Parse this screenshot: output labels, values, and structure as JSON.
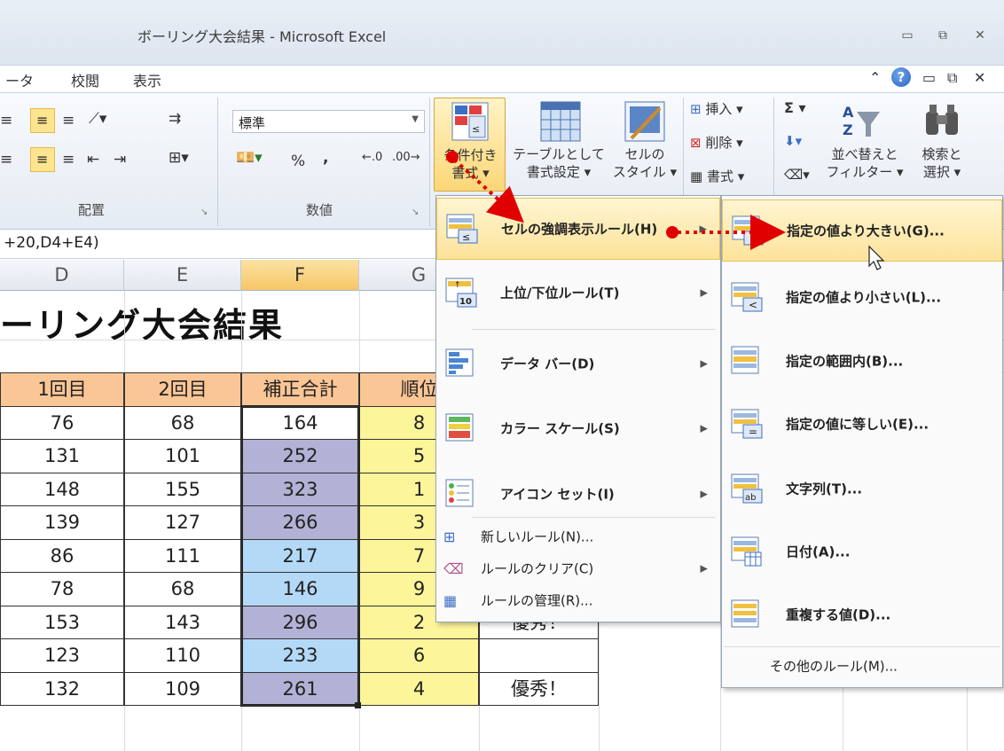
{
  "window": {
    "title": "ボーリング大会結果 - Microsoft Excel",
    "controls": [
      "▭",
      "⧉",
      "✕"
    ]
  },
  "ribbon_tabs": [
    "ータ",
    "校閲",
    "表示"
  ],
  "ribbon": {
    "group_labels": {
      "alignment": "配置",
      "number": "数値"
    },
    "number_format": "標準",
    "percent": "%",
    "comma": ",",
    "inc_decimal": ".0",
    "dec_decimal": ".00",
    "conditional_format": {
      "line1": "条件付き",
      "line2": "書式 ▾"
    },
    "format_as_table": {
      "line1": "テーブルとして",
      "line2": "書式設定 ▾"
    },
    "cell_styles": {
      "line1": "セルの",
      "line2": "スタイル ▾"
    },
    "insert": "挿入 ▾",
    "delete": "削除 ▾",
    "format": "書式 ▾",
    "sigma": "Σ ▾",
    "sort_filter": {
      "line1": "並べ替えと",
      "line2": "フィルター ▾"
    },
    "find_select": {
      "line1": "検索と",
      "line2": "選択 ▾"
    }
  },
  "formula_bar": {
    "text": "+20,D4+E4)"
  },
  "columns": [
    "D",
    "E",
    "F",
    "G"
  ],
  "sheet": {
    "title": "ーリング大会結果",
    "headers": [
      "1回目",
      "2回目",
      "補正合計",
      "順位"
    ],
    "rows": [
      {
        "d": "76",
        "e": "68",
        "f": "164",
        "g": "8",
        "h": ""
      },
      {
        "d": "131",
        "e": "101",
        "f": "252",
        "g": "5",
        "h": ""
      },
      {
        "d": "148",
        "e": "155",
        "f": "323",
        "g": "1",
        "h": ""
      },
      {
        "d": "139",
        "e": "127",
        "f": "266",
        "g": "3",
        "h": ""
      },
      {
        "d": "86",
        "e": "111",
        "f": "217",
        "g": "7",
        "h": ""
      },
      {
        "d": "78",
        "e": "68",
        "f": "146",
        "g": "9",
        "h": ""
      },
      {
        "d": "153",
        "e": "143",
        "f": "296",
        "g": "2",
        "h": "優秀！"
      },
      {
        "d": "123",
        "e": "110",
        "f": "233",
        "g": "6",
        "h": ""
      },
      {
        "d": "132",
        "e": "109",
        "f": "261",
        "g": "4",
        "h": "優秀！"
      }
    ],
    "colors": {
      "header_bg": "#fbc696",
      "f_purple": "#b2b2d6",
      "f_blue": "#b3d9f7",
      "g_yellow": "#fdf59a"
    }
  },
  "cf_menu": {
    "items": [
      {
        "label": "セルの強調表示ルール(H)",
        "icon": "highlight-rules-icon"
      },
      {
        "label": "上位/下位ルール(T)",
        "icon": "top-bottom-icon"
      },
      {
        "label": "データ バー(D)",
        "icon": "data-bars-icon"
      },
      {
        "label": "カラー スケール(S)",
        "icon": "color-scales-icon"
      },
      {
        "label": "アイコン セット(I)",
        "icon": "icon-sets-icon"
      }
    ],
    "small_items": [
      {
        "label": "新しいルール(N)...",
        "icon": "new-rule-icon"
      },
      {
        "label": "ルールのクリア(C)",
        "icon": "clear-rules-icon"
      },
      {
        "label": "ルールの管理(R)...",
        "icon": "manage-rules-icon"
      }
    ]
  },
  "highlight_submenu": {
    "items": [
      {
        "label": "指定の値より大きい(G)...",
        "icon": "greater-than-icon"
      },
      {
        "label": "指定の値より小さい(L)...",
        "icon": "less-than-icon"
      },
      {
        "label": "指定の範囲内(B)...",
        "icon": "between-icon"
      },
      {
        "label": "指定の値に等しい(E)...",
        "icon": "equal-to-icon"
      },
      {
        "label": "文字列(T)...",
        "icon": "text-contains-icon"
      },
      {
        "label": "日付(A)...",
        "icon": "date-occurring-icon"
      },
      {
        "label": "重複する値(D)...",
        "icon": "duplicate-values-icon"
      }
    ],
    "more_rules": "その他のルール(M)..."
  }
}
